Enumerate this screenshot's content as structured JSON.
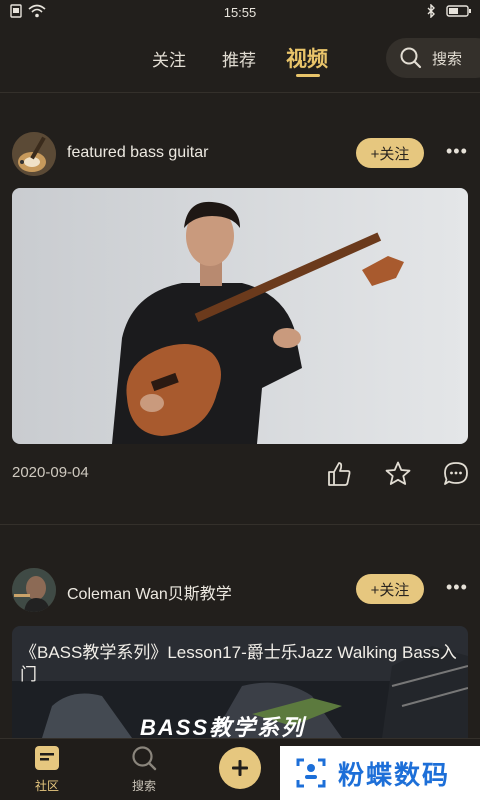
{
  "status_bar": {
    "time": "15:55"
  },
  "top_nav": {
    "tabs": [
      {
        "label": "关注"
      },
      {
        "label": "推荐"
      },
      {
        "label": "视频"
      }
    ],
    "search_label": "搜索"
  },
  "posts": [
    {
      "author": "featured bass guitar",
      "follow_label": "+关注",
      "date": "2020-09-04"
    },
    {
      "author": "Coleman Wan贝斯教学",
      "follow_label": "+关注",
      "video_title": "《BASS教学系列》Lesson17-爵士乐Jazz Walking Bass入门",
      "video_banner": "BASS教学系列"
    }
  ],
  "bottom_nav": {
    "items": [
      {
        "label": "社区"
      },
      {
        "label": "搜索"
      }
    ]
  },
  "watermark": {
    "text": "粉蝶数码"
  },
  "colors": {
    "accent": "#e6c77f",
    "background": "#221f1c"
  }
}
